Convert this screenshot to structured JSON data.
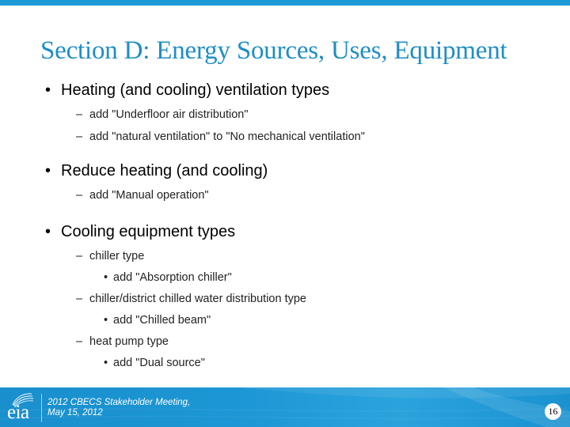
{
  "slide": {
    "title": "Section D: Energy Sources, Uses, Equipment",
    "accent_color": "#1e9ad6",
    "title_color": "#1f8dc4",
    "bullets": [
      {
        "text": "Heating (and cooling) ventilation types",
        "marker": "•",
        "children": [
          {
            "text": "add \"Underfloor air distribution\"",
            "marker": "–"
          },
          {
            "text": "add \"natural ventilation\" to \"No mechanical ventilation\"",
            "marker": "–"
          }
        ]
      },
      {
        "text": "Reduce heating (and cooling)",
        "marker": "•",
        "children": [
          {
            "text": "add \"Manual operation\"",
            "marker": "–"
          }
        ]
      },
      {
        "text": "Cooling equipment types",
        "marker": "•",
        "children": [
          {
            "text": "chiller type",
            "marker": "–",
            "children": [
              {
                "text": "add \"Absorption chiller\"",
                "marker": "•"
              }
            ]
          },
          {
            "text": "chiller/district chilled water distribution type",
            "marker": "–",
            "children": [
              {
                "text": "add \"Chilled beam\"",
                "marker": "•"
              }
            ]
          },
          {
            "text": "heat pump type",
            "marker": "–",
            "children": [
              {
                "text": "add \"Dual source\"",
                "marker": "•"
              }
            ]
          }
        ]
      }
    ]
  },
  "footer": {
    "logo_text": "eia",
    "logo_icon": "eia-swoosh-logo",
    "line1": "2012 CBECS Stakeholder Meeting,",
    "line2": "May 15, 2012",
    "page_number": "16"
  }
}
